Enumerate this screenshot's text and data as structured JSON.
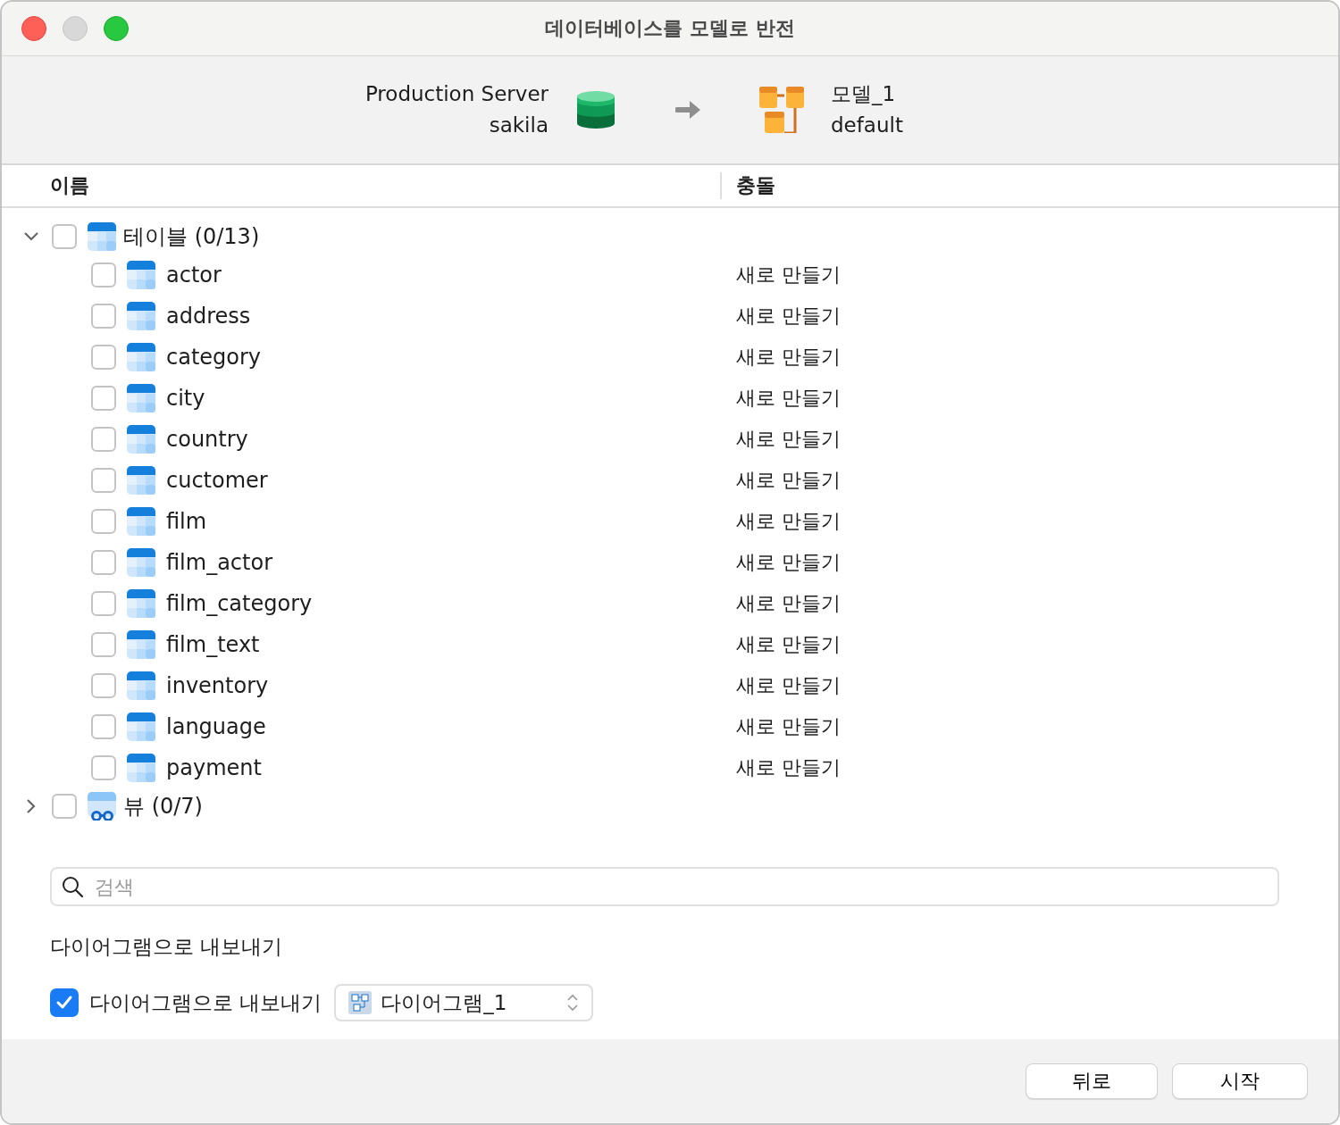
{
  "window": {
    "title": "데이터베이스를 모델로 반전"
  },
  "source": {
    "connection": "Production Server",
    "database": "sakila"
  },
  "target": {
    "model": "모델_1",
    "schema": "default"
  },
  "table": {
    "columns": [
      "이름",
      "충돌"
    ],
    "groups": [
      {
        "kind": "tables",
        "label": "테이블 (0/13)",
        "expanded": true,
        "checked": false,
        "children": [
          {
            "name": "actor",
            "conflict": "새로 만들기",
            "checked": false
          },
          {
            "name": "address",
            "conflict": "새로 만들기",
            "checked": false
          },
          {
            "name": "category",
            "conflict": "새로 만들기",
            "checked": false
          },
          {
            "name": "city",
            "conflict": "새로 만들기",
            "checked": false
          },
          {
            "name": "country",
            "conflict": "새로 만들기",
            "checked": false
          },
          {
            "name": "cuctomer",
            "conflict": "새로 만들기",
            "checked": false
          },
          {
            "name": "film",
            "conflict": "새로 만들기",
            "checked": false
          },
          {
            "name": "film_actor",
            "conflict": "새로 만들기",
            "checked": false
          },
          {
            "name": "film_category",
            "conflict": "새로 만들기",
            "checked": false
          },
          {
            "name": "film_text",
            "conflict": "새로 만들기",
            "checked": false
          },
          {
            "name": "inventory",
            "conflict": "새로 만들기",
            "checked": false
          },
          {
            "name": "language",
            "conflict": "새로 만들기",
            "checked": false
          },
          {
            "name": "payment",
            "conflict": "새로 만들기",
            "checked": false
          }
        ]
      },
      {
        "kind": "views",
        "label": "뷰 (0/7)",
        "expanded": false,
        "checked": false
      }
    ]
  },
  "search": {
    "placeholder": "검색"
  },
  "export": {
    "section_label": "다이어그램으로 내보내기",
    "checkbox_label": "다이어그램으로 내보내기",
    "checked": true,
    "diagram": "다이어그램_1"
  },
  "buttons": [
    "뒤로",
    "시작"
  ]
}
